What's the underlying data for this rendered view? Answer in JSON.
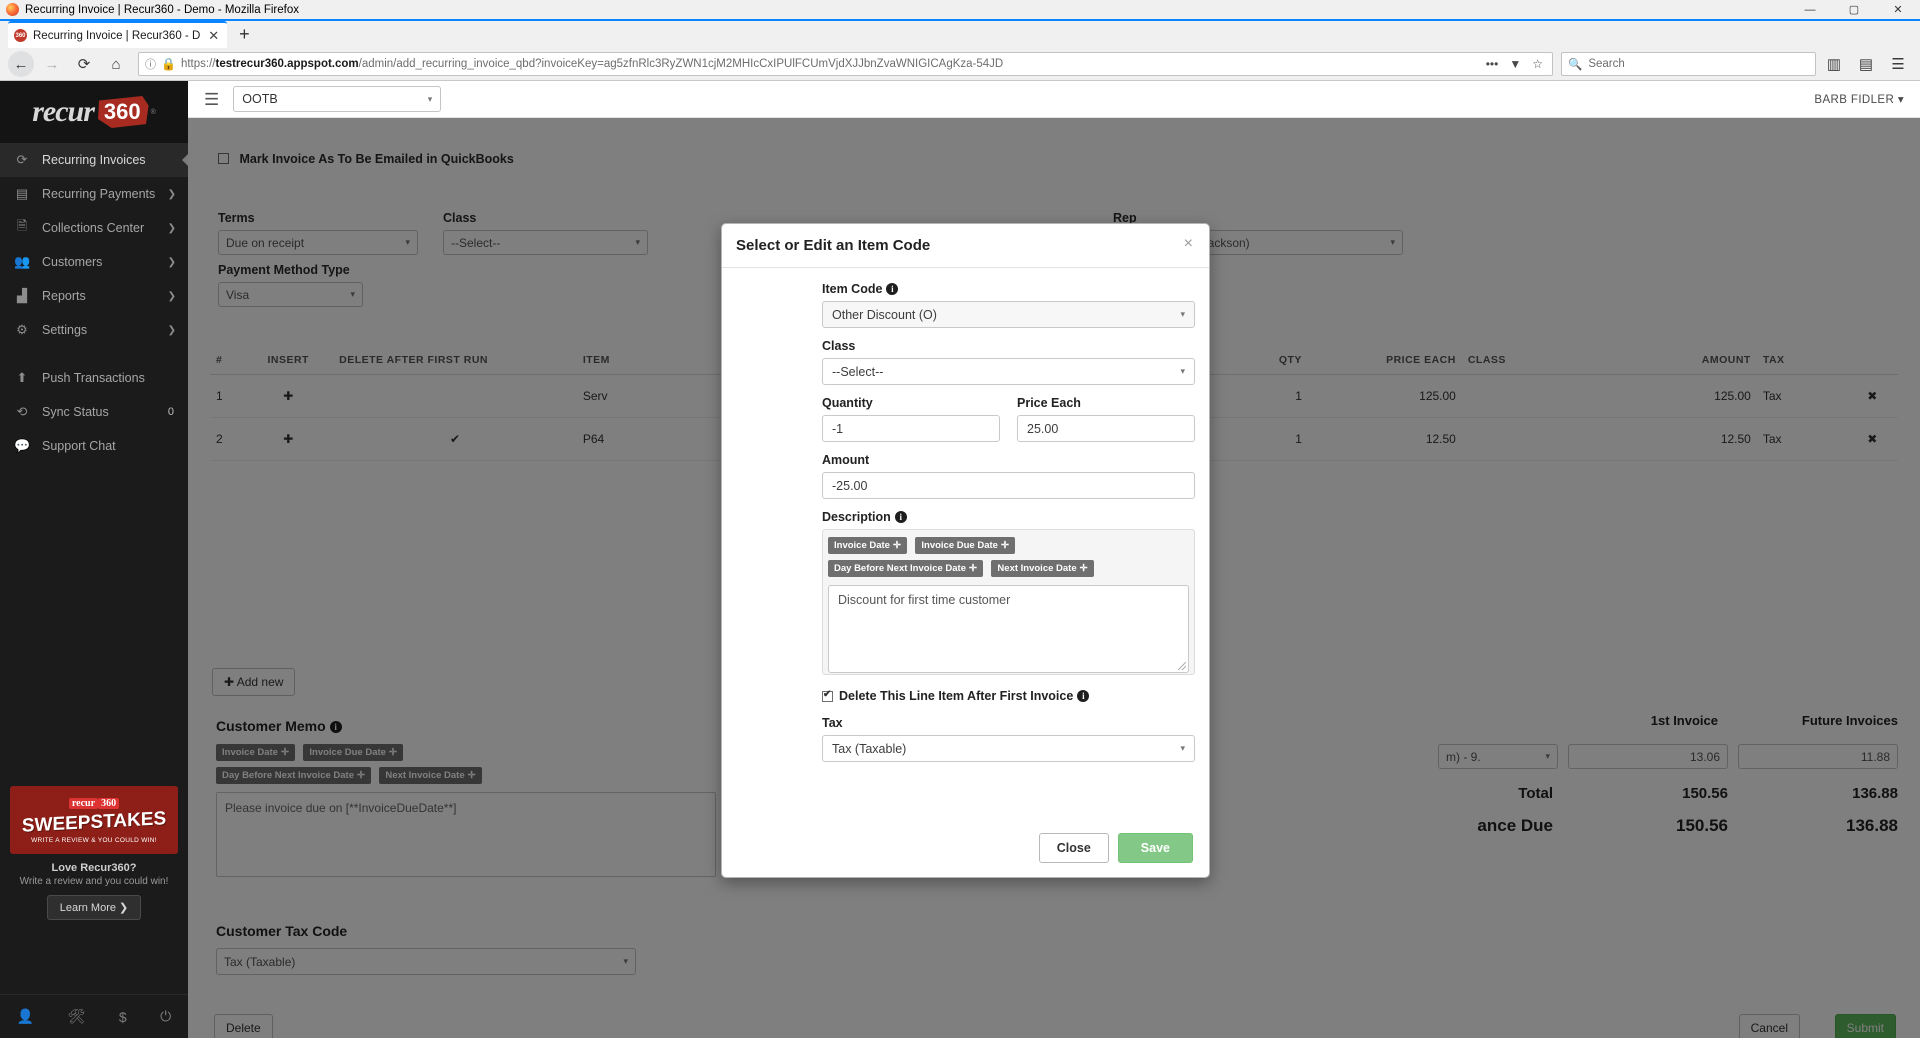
{
  "browser": {
    "window_title": "Recurring Invoice | Recur360 - Demo - Mozilla Firefox",
    "minimize": "—",
    "maximize": "▢",
    "close": "✕",
    "tab_title": "Recurring Invoice | Recur360 - D",
    "tab_favicon_text": "360",
    "tab_close": "✕",
    "new_tab": "+",
    "back": "←",
    "forward": "→",
    "reload": "⟳",
    "home": "⌂",
    "info_icon": "ⓘ",
    "lock_icon": "🔒",
    "url_domain": "testrecur360.appspot.com",
    "url_prefix": "https://",
    "url_path": "/admin/add_recurring_invoice_qbd?invoiceKey=ag5zfnRlc3RyZWN1cjM2MHIcCxIPUlFCUmVjdXJJbnZvaWNIGICAgKza-54JD",
    "page_actions": "•••",
    "pocket_icon": "▼",
    "bookmark_icon": "☆",
    "search_placeholder": "Search",
    "search_icon": "🔍",
    "library_icon": "▥",
    "sidebar_icon": "▤",
    "menu_icon": "☰"
  },
  "sidebar": {
    "logo_text": "recur",
    "logo_badge": "360",
    "logo_reg": "®",
    "items": [
      {
        "label": "Recurring Invoices",
        "icon": "refresh-icon",
        "glyph": "⟳",
        "active": true,
        "chevron": ""
      },
      {
        "label": "Recurring Payments",
        "icon": "card-icon",
        "glyph": "▤",
        "active": false,
        "chevron": "❯"
      },
      {
        "label": "Collections Center",
        "icon": "document-icon",
        "glyph": "🗎",
        "active": false,
        "chevron": "❯"
      },
      {
        "label": "Customers",
        "icon": "people-icon",
        "glyph": "👥",
        "active": false,
        "chevron": "❯"
      },
      {
        "label": "Reports",
        "icon": "chart-icon",
        "glyph": "▟",
        "active": false,
        "chevron": "❯"
      },
      {
        "label": "Settings",
        "icon": "gears-icon",
        "glyph": "⚙",
        "active": false,
        "chevron": "❯"
      }
    ],
    "items2": [
      {
        "label": "Push Transactions",
        "icon": "upload-icon",
        "glyph": "⬆",
        "badge": ""
      },
      {
        "label": "Sync Status",
        "icon": "sync-icon",
        "glyph": "⟲",
        "badge": "0"
      },
      {
        "label": "Support Chat",
        "icon": "chat-icon",
        "glyph": "💬",
        "badge": ""
      }
    ],
    "promo": {
      "logo_text": "recur",
      "logo_badge": "360",
      "headline": "SWEEPSTAKES",
      "subline": "WRITE A REVIEW & YOU COULD WIN!",
      "title": "Love Recur360?",
      "subtitle": "Write a review and you could win!",
      "button": "Learn More ❯"
    },
    "footer_icons": [
      "user-icon",
      "wrench-icon",
      "dollar-icon",
      "power-icon"
    ],
    "footer_glyphs": [
      "👤",
      "🛠",
      "$",
      "⏻"
    ]
  },
  "topbar": {
    "hamburger": "☰",
    "company": "OOTB",
    "company_caret": "▾",
    "user": "BARB FIDLER",
    "user_caret": "▾"
  },
  "invoice_form": {
    "email_checkbox_label": "Mark Invoice As To Be Emailed in QuickBooks",
    "email_checkbox_checked": false,
    "fields": [
      {
        "label": "Terms",
        "value": "Due on receipt"
      },
      {
        "label": "Class",
        "value": "--Select--"
      },
      {
        "label": "Rep",
        "value": "FWJ (Frank W Jackson)"
      },
      {
        "label": "Payment Method Type",
        "value": "Visa"
      }
    ],
    "table": {
      "headers": [
        "#",
        "INSERT",
        "DELETE AFTER FIRST RUN",
        "ITEM",
        "QTY",
        "PRICE EACH",
        "CLASS",
        "AMOUNT",
        "TAX"
      ],
      "rows": [
        {
          "num": "1",
          "insert": "✚",
          "delete_after": "",
          "item": "Serv",
          "qty": "1",
          "price": "125.00",
          "class": "",
          "amount": "125.00",
          "tax": "Tax",
          "remove": "✖"
        },
        {
          "num": "2",
          "insert": "✚",
          "delete_after": "✔",
          "item": "P64",
          "qty": "1",
          "price": "12.50",
          "class": "",
          "amount": "12.50",
          "tax": "Tax",
          "remove": "✖"
        }
      ]
    },
    "add_new_button": "✚ Add new",
    "customer_memo_label": "Customer Memo",
    "memo_tags": [
      "Invoice Date",
      "Invoice Due Date",
      "Day Before Next Invoice Date",
      "Next Invoice Date"
    ],
    "memo_value": "Please invoice due on [**InvoiceDueDate**]",
    "customer_tax_code_label": "Customer Tax Code",
    "customer_tax_code_value": "Tax (Taxable)",
    "summary": {
      "col1": "1st Invoice",
      "col2": "Future Invoices",
      "partial_select": "m) - 9.",
      "sub1": "13.06",
      "sub2": "11.88",
      "total_label": "Total",
      "total1": "150.56",
      "total2": "136.88",
      "balance_label": "ance Due",
      "balance1": "150.56",
      "balance2": "136.88"
    },
    "delete_button": "Delete",
    "cancel_button": "Cancel",
    "submit_button": "Submit"
  },
  "modal": {
    "title": "Select or Edit an Item Code",
    "close_x": "×",
    "item_code_label": "Item Code",
    "item_code_value": "Other Discount (O)",
    "item_code_caret": "▾",
    "class_label": "Class",
    "class_value": "--Select--",
    "class_caret": "▾",
    "quantity_label": "Quantity",
    "quantity_value": "-1",
    "price_each_label": "Price Each",
    "price_each_value": "25.00",
    "amount_label": "Amount",
    "amount_value": "-25.00",
    "description_label": "Description",
    "description_tags": [
      {
        "label": "Invoice Date",
        "plus": "✛"
      },
      {
        "label": "Invoice Due Date",
        "plus": "✛"
      },
      {
        "label": "Day Before Next Invoice Date",
        "plus": "✛"
      },
      {
        "label": "Next Invoice Date",
        "plus": "✛"
      }
    ],
    "description_value": "Discount for first time customer",
    "delete_checkbox_label": "Delete This Line Item After First Invoice",
    "delete_checkbox_checked": true,
    "tax_label": "Tax",
    "tax_value": "Tax (Taxable)",
    "tax_caret": "▾",
    "close_button": "Close",
    "save_button": "Save",
    "info_glyph": "i"
  },
  "colors": {
    "sidebar_bg": "#1b1b1b",
    "brand_red": "#a82b21",
    "save_green": "#6fbf73",
    "lock_green": "#12bc00",
    "tab_accent": "#0a84ff"
  }
}
